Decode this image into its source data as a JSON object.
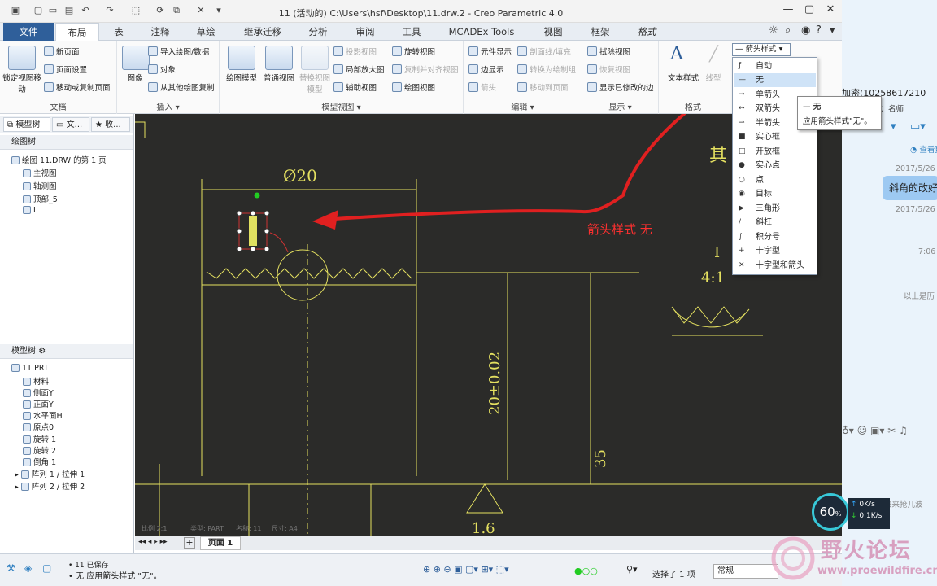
{
  "window": {
    "title": "11 (活动的) C:\\Users\\hsf\\Desktop\\11.drw.2 - Creo Parametric 4.0"
  },
  "tabs": [
    {
      "label": "文件"
    },
    {
      "label": "布局"
    },
    {
      "label": "表"
    },
    {
      "label": "注释"
    },
    {
      "label": "草绘"
    },
    {
      "label": "继承迁移"
    },
    {
      "label": "分析"
    },
    {
      "label": "审阅"
    },
    {
      "label": "工具"
    },
    {
      "label": "MCADEx Tools"
    },
    {
      "label": "视图"
    },
    {
      "label": "框架"
    },
    {
      "label": "格式"
    }
  ],
  "ribbon": {
    "doc": {
      "label": "文档",
      "lock_view": "锁定视图移动",
      "new_page": "新页面",
      "page_setup": "页面设置",
      "move_copy_page": "移动或复制页面"
    },
    "insert": {
      "label": "插入",
      "image": "图像",
      "import": "导入绘图/数据",
      "object": "对象",
      "copy_from": "从其他绘图复制"
    },
    "model_view": {
      "label": "模型视图",
      "drawing_model": "绘图模型",
      "general_view": "普通视图",
      "alt_view": "替换视图模型",
      "projection": "投影视图",
      "detail": "局部放大图",
      "auxiliary": "辅助视图",
      "revolved": "旋转视图",
      "copy_align": "复制并对齐视图",
      "drawing_view": "绘图视图"
    },
    "edit": {
      "label": "编辑",
      "comp_display": "元件显示",
      "edge_display": "边显示",
      "arrow": "箭头",
      "section_line": "剖面线/填充",
      "convert_draw": "转换为绘制组",
      "move_page": "移动到页面"
    },
    "display": {
      "label": "显示",
      "erase_view": "拭除视图",
      "restore_view": "恢复视图",
      "show_modified": "显示已修改的边"
    },
    "format": {
      "label": "格式",
      "text_style": "文本样式",
      "line_style": "线型",
      "arrow_style": "箭头样式"
    }
  },
  "left_panel": {
    "tabs": [
      "模型树",
      "文...",
      "收..."
    ],
    "drawing_tree": {
      "header": "绘图树",
      "items": [
        "绘图 11.DRW 的第 1 页",
        "主视图",
        "轴测图",
        "顶部_5",
        "I"
      ]
    },
    "model_tree": {
      "header": "模型树",
      "items": [
        "11.PRT",
        "材料",
        "侧面Y",
        "正面Y",
        "水平面H",
        "原点0",
        "旋转 1",
        "旋转 2",
        "倒角 1",
        "阵列 1 / 拉伸 1",
        "阵列 2 / 拉伸 2"
      ]
    }
  },
  "drawing": {
    "dim_diameter": "Ø20",
    "dim_tolerance": "20±0.02",
    "dim_35": "35",
    "dim_16": "1.6",
    "scale_label": "4:1",
    "detail_label": "I",
    "side_text": "其",
    "annotation": "箭头样式 无",
    "footer": [
      "比例 2:1",
      "类型: PART",
      "名称: 11",
      "尺寸: A4"
    ]
  },
  "arrow_dropdown": {
    "header": "— 箭头样式",
    "items": [
      {
        "glyph": "ƒ",
        "label": "自动"
      },
      {
        "glyph": "—",
        "label": "无"
      },
      {
        "glyph": "→",
        "label": "单箭头"
      },
      {
        "glyph": "↔",
        "label": "双箭头"
      },
      {
        "glyph": "⇀",
        "label": "半箭头"
      },
      {
        "glyph": "■",
        "label": "实心框"
      },
      {
        "glyph": "□",
        "label": "开放框"
      },
      {
        "glyph": "●",
        "label": "实心点"
      },
      {
        "glyph": "○",
        "label": "点"
      },
      {
        "glyph": "◉",
        "label": "目标"
      },
      {
        "glyph": "▶",
        "label": "三角形"
      },
      {
        "glyph": "/",
        "label": "斜杠"
      },
      {
        "glyph": "∫",
        "label": "积分号"
      },
      {
        "glyph": "+",
        "label": "十字型"
      },
      {
        "glyph": "✕",
        "label": "十字型和箭头"
      }
    ]
  },
  "tooltip": {
    "title": "— 无",
    "body": "应用箭头样式\"无\"。"
  },
  "page_tab": "页面 1",
  "status": {
    "message_top": "• 11 已保存",
    "message": "• 无 应用箭头样式 \"无\"。",
    "selected": "选择了 1 项",
    "filter": "常规"
  },
  "side_app": {
    "header": "加密(10258617210",
    "sub": "小贾四种人：名师",
    "view_more": "查看更",
    "date1": "2017/5/26",
    "bubble": "斜角的改好",
    "date2": "2017/5/26",
    "time": "7:06",
    "history": "以上是历",
    "grab": "快来抢几波"
  },
  "net_widget": {
    "percent": "60",
    "percent_unit": "%",
    "up": "0K/s",
    "down": "0.1K/s"
  },
  "watermark": {
    "text": "野火论坛",
    "url": "www.proewildfire.cn"
  },
  "colors": {
    "canvas": "#2b2b29",
    "drawing": "#e4e060",
    "annotation": "#e02020",
    "file_tab": "#2f5f9a"
  }
}
